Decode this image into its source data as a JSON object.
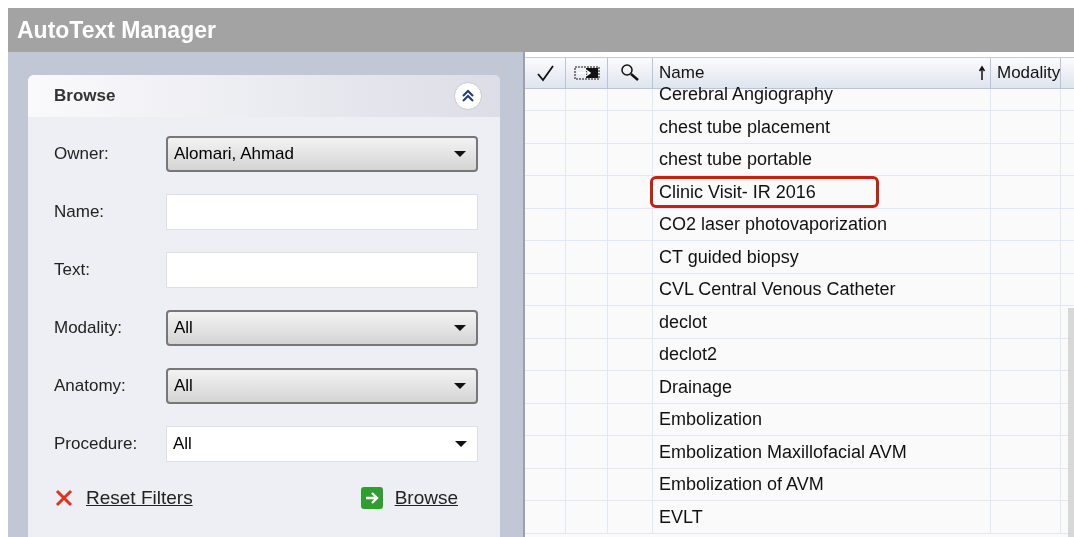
{
  "window": {
    "title": "AutoText Manager"
  },
  "browse": {
    "title": "Browse",
    "expanded": true,
    "fields": [
      {
        "label": "Owner:",
        "kind": "select",
        "value": "Alomari, Ahmad"
      },
      {
        "label": "Name:",
        "kind": "text"
      },
      {
        "label": "Text:",
        "kind": "text"
      },
      {
        "label": "Modality:",
        "kind": "select",
        "value": "All"
      },
      {
        "label": "Anatomy:",
        "kind": "select",
        "value": "All"
      },
      {
        "label": "Procedure:",
        "kind": "combo",
        "value": "All"
      }
    ],
    "actions": [
      {
        "label": "Reset Filters",
        "kind": "reset"
      },
      {
        "label": "Browse",
        "kind": "go"
      }
    ]
  },
  "table": {
    "columns": [
      {
        "kind": "check"
      },
      {
        "kind": "insert"
      },
      {
        "kind": "search"
      },
      {
        "kind": "text",
        "label": "Name",
        "sorted": true
      },
      {
        "kind": "text",
        "label": "Modality"
      }
    ],
    "rows": [
      {
        "name": "Cerebral Angiography",
        "highlighted": false
      },
      {
        "name": "chest tube placement",
        "highlighted": false
      },
      {
        "name": "chest tube portable",
        "highlighted": false
      },
      {
        "name": "Clinic Visit- IR 2016",
        "highlighted": true
      },
      {
        "name": "CO2 laser photovaporization",
        "highlighted": false
      },
      {
        "name": "CT guided biopsy",
        "highlighted": false
      },
      {
        "name": "CVL Central Venous Catheter",
        "highlighted": false
      },
      {
        "name": "declot",
        "highlighted": false
      },
      {
        "name": "declot2",
        "highlighted": false
      },
      {
        "name": "Drainage",
        "highlighted": false
      },
      {
        "name": "Embolization",
        "highlighted": false
      },
      {
        "name": "Embolization Maxillofacial AVM",
        "highlighted": false
      },
      {
        "name": "Embolization of AVM",
        "highlighted": false
      },
      {
        "name": "EVLT",
        "highlighted": false
      }
    ]
  }
}
